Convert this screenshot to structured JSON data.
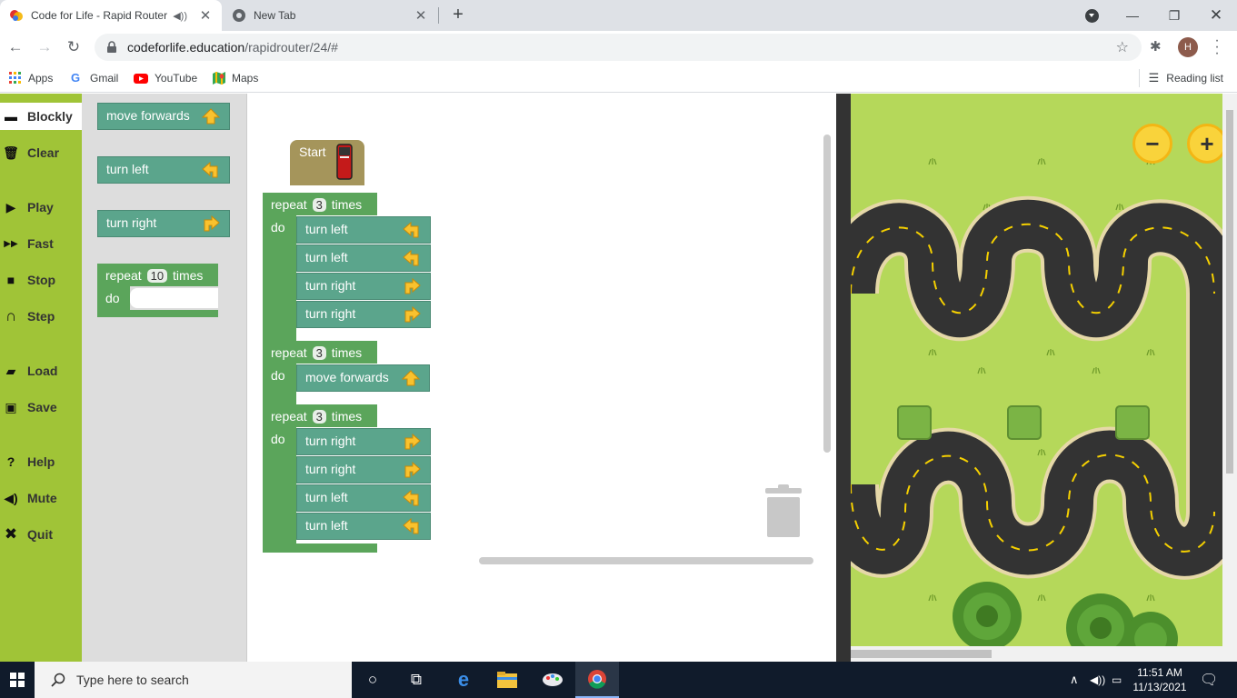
{
  "browser": {
    "tabs": [
      {
        "title": "Code for Life - Rapid Router",
        "active": true,
        "audio": true
      },
      {
        "title": "New Tab",
        "active": false
      }
    ],
    "url_host": "codeforlife.education",
    "url_path": "/rapidrouter/24/#",
    "avatar_letter": "H",
    "bookmarks": [
      "Apps",
      "Gmail",
      "YouTube",
      "Maps"
    ],
    "reading_list": "Reading list"
  },
  "menu": {
    "items": [
      "Blockly",
      "Clear",
      "Play",
      "Fast",
      "Stop",
      "Step",
      "Load",
      "Save",
      "Help",
      "Mute",
      "Quit"
    ],
    "selected": "Blockly"
  },
  "toolbox": {
    "move_forwards": "move forwards",
    "turn_left": "turn left",
    "turn_right": "turn right",
    "repeat_word": "repeat",
    "times_word": "times",
    "do_word": "do",
    "repeat_count": "10"
  },
  "program": {
    "start": "Start",
    "loops": [
      {
        "count": "3",
        "body": [
          "turn left",
          "turn left",
          "turn right",
          "turn right"
        ]
      },
      {
        "count": "3",
        "body": [
          "move forwards"
        ]
      },
      {
        "count": "3",
        "body": [
          "turn right",
          "turn right",
          "turn left",
          "turn left"
        ]
      }
    ]
  },
  "map": {
    "zoom_out": "−",
    "zoom_in": "+"
  },
  "taskbar": {
    "search_placeholder": "Type here to search",
    "time": "11:51 AM",
    "date": "11/13/2021"
  },
  "colors": {
    "menu_bg": "#a0c437",
    "loop_block": "#5ba55b",
    "move_block": "#5ba58c",
    "start_block": "#a5955b",
    "grass": "#b5d85a",
    "road": "#333333",
    "road_edge": "#e6d8a8"
  }
}
